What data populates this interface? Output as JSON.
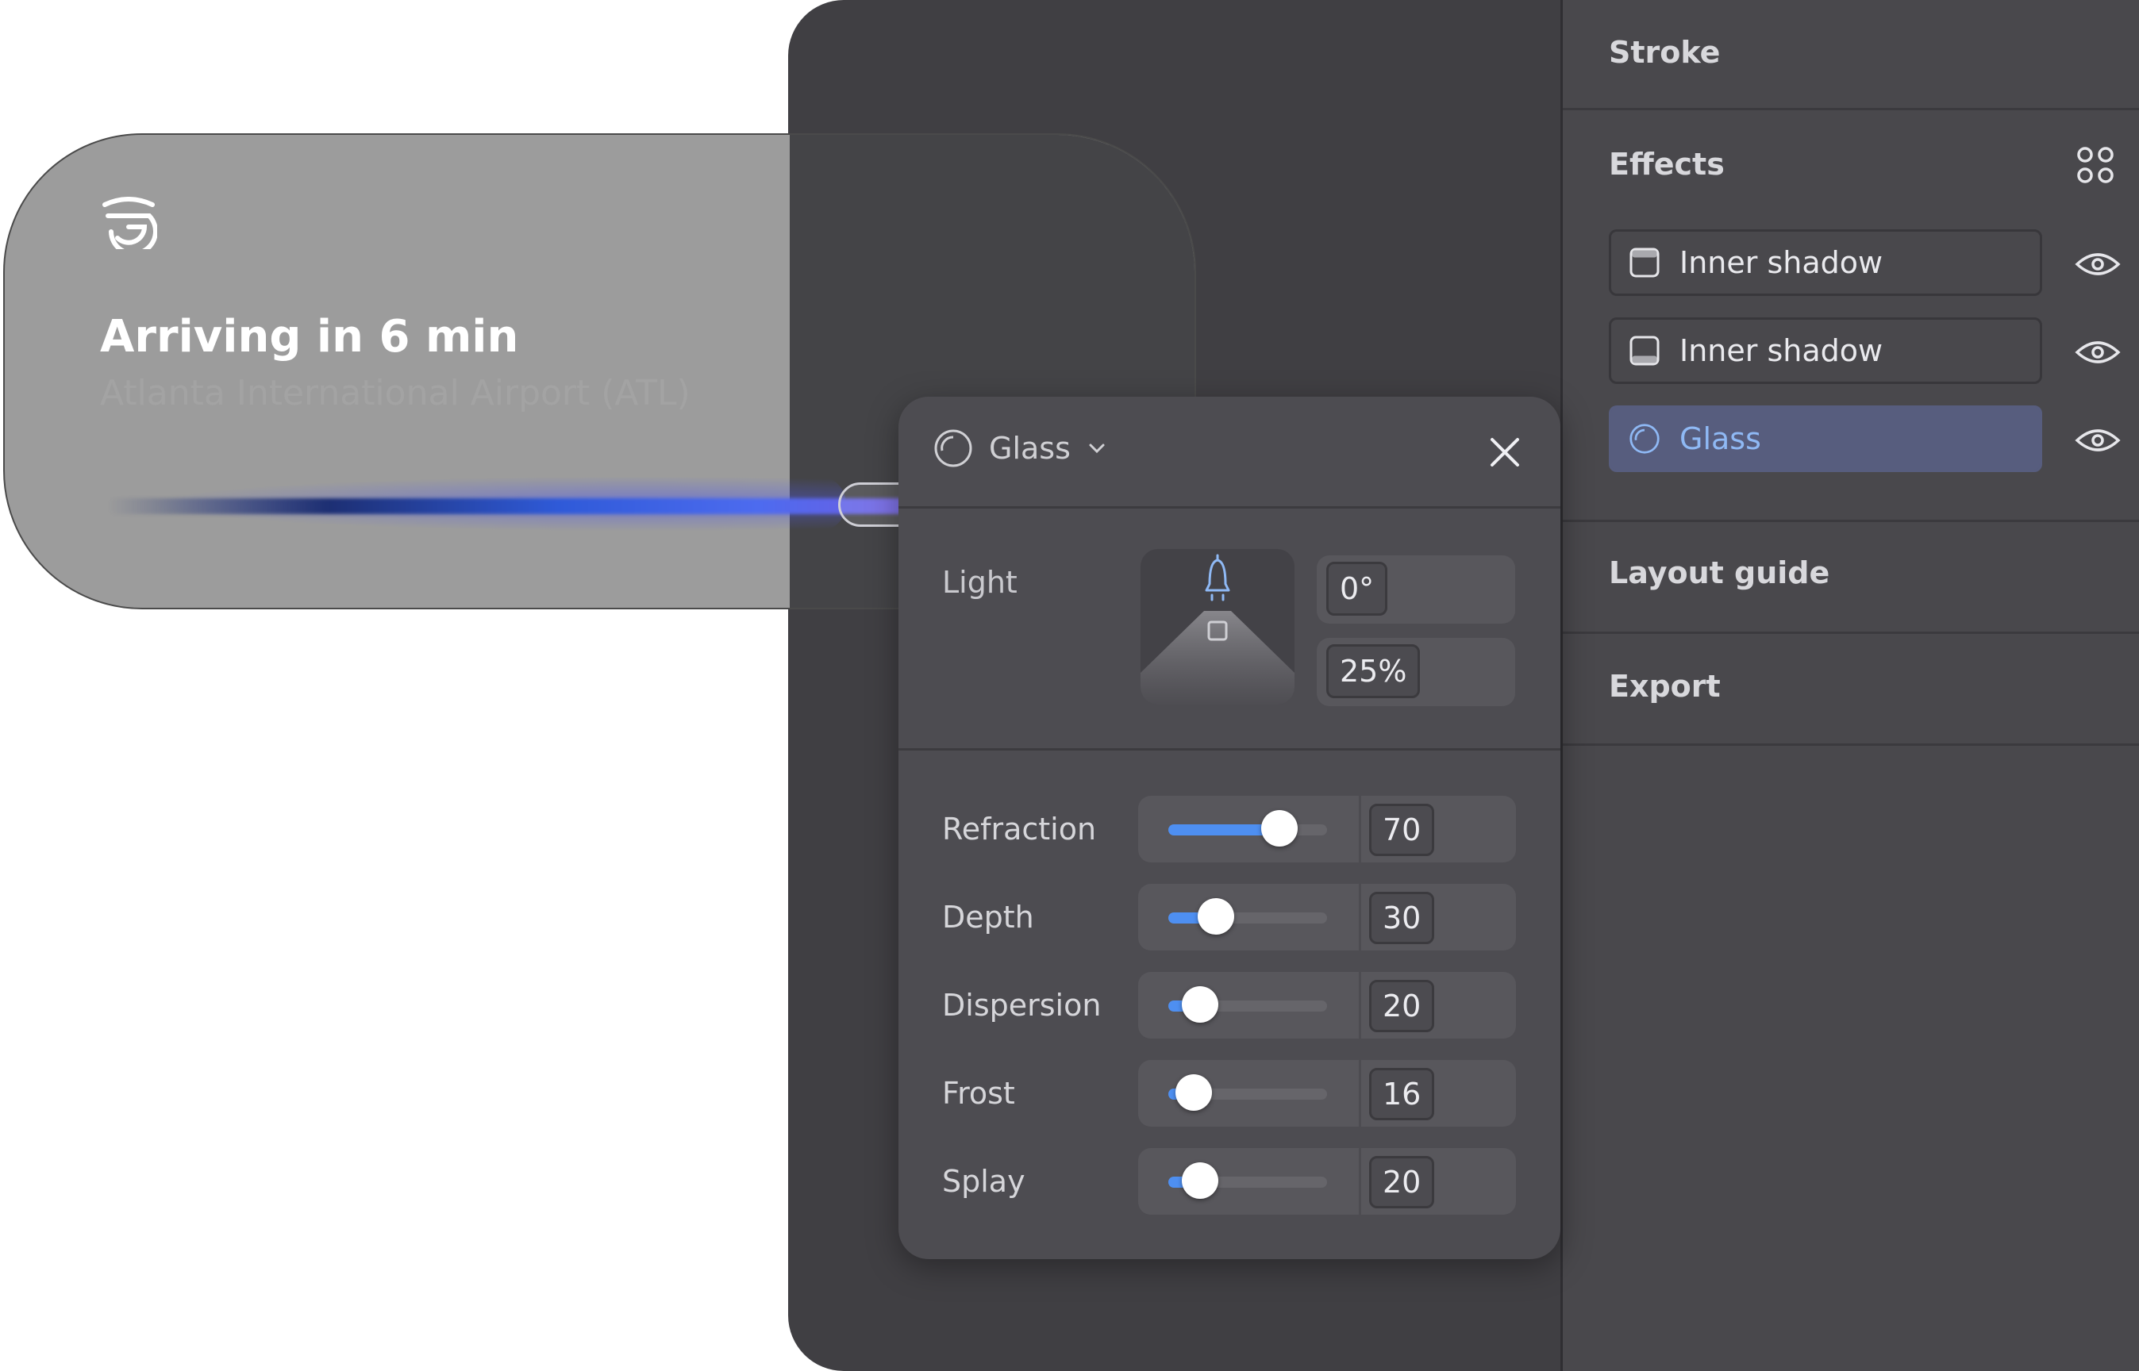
{
  "card": {
    "title": "Arriving in 6 min",
    "subtitle": "Atlanta International Airport (ATL)",
    "logo_icon": "brand-g-logo"
  },
  "popover": {
    "effect_type": "Glass",
    "light": {
      "label": "Light",
      "angle": "0°",
      "intensity": "25%"
    },
    "sliders": [
      {
        "label": "Refraction",
        "value": "70",
        "level": 0.7
      },
      {
        "label": "Depth",
        "value": "30",
        "level": 0.3
      },
      {
        "label": "Dispersion",
        "value": "20",
        "level": 0.2
      },
      {
        "label": "Frost",
        "value": "16",
        "level": 0.16
      },
      {
        "label": "Splay",
        "value": "20",
        "level": 0.2
      }
    ]
  },
  "panel": {
    "stroke_title": "Stroke",
    "effects_title": "Effects",
    "effects": [
      {
        "label": "Inner shadow",
        "icon": "inner-shadow-top-icon",
        "active": false
      },
      {
        "label": "Inner shadow",
        "icon": "inner-shadow-bottom-icon",
        "active": false
      },
      {
        "label": "Glass",
        "icon": "glass-icon",
        "active": true
      }
    ],
    "layout_guide_title": "Layout guide",
    "export_title": "Export"
  },
  "colors": {
    "accent": "#4e8ff1",
    "active_row": "#575d7e",
    "panel_bg": "#49484c",
    "canvas_bg": "#403f43"
  }
}
